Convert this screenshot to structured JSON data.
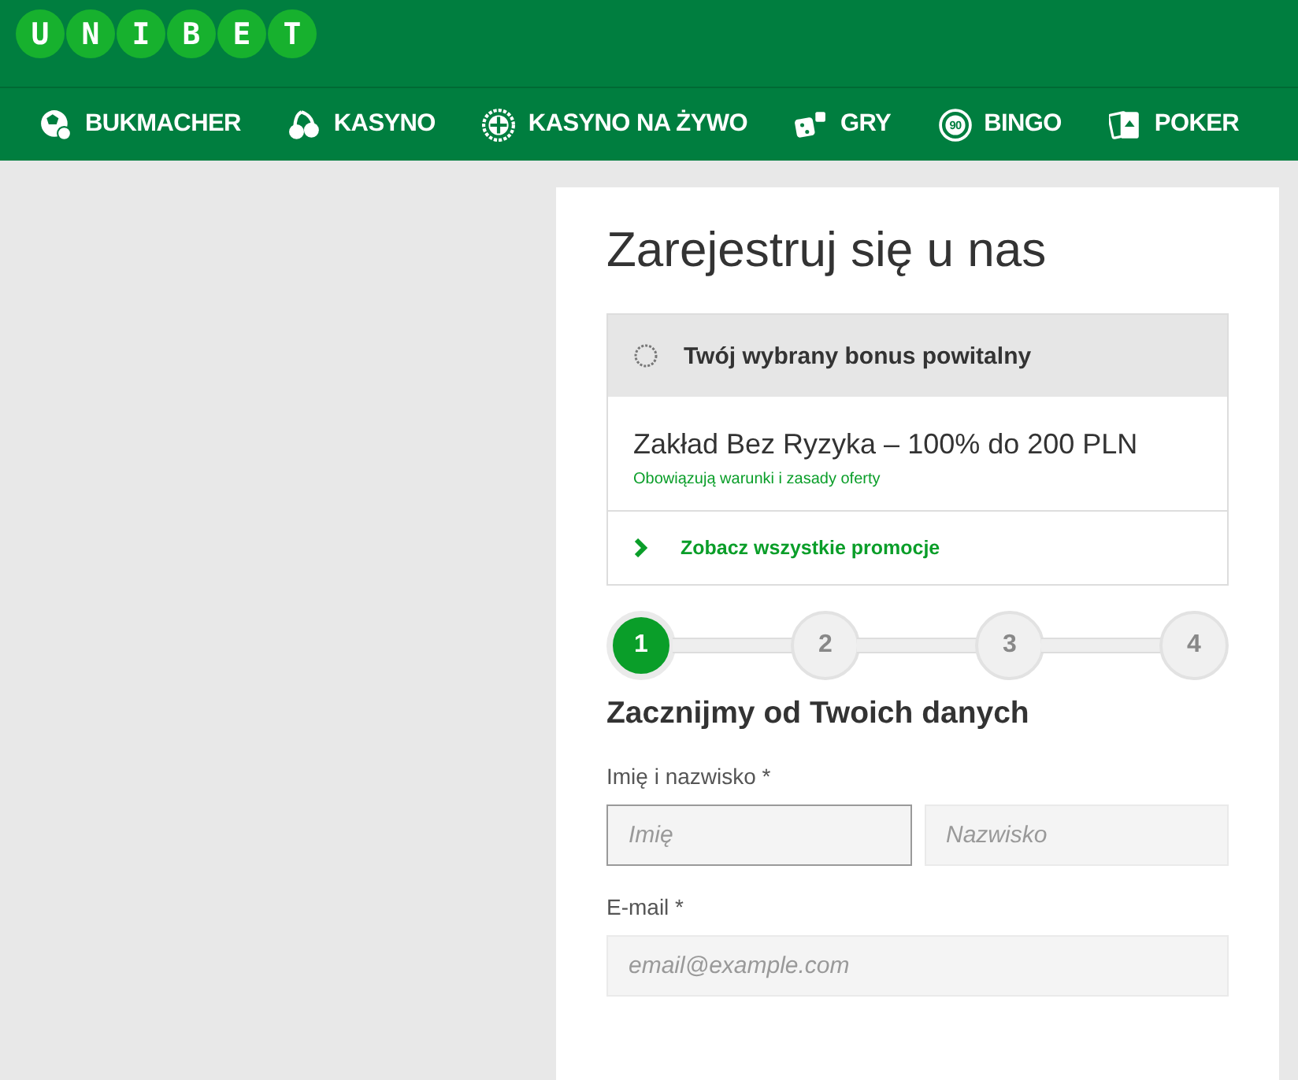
{
  "logo": {
    "letters": [
      "U",
      "N",
      "I",
      "B",
      "E",
      "T"
    ]
  },
  "nav": [
    {
      "label": "BUKMACHER",
      "kind": "ball"
    },
    {
      "label": "KASYNO",
      "kind": "cherry"
    },
    {
      "label": "KASYNO NA ŻYWO",
      "kind": "roulette"
    },
    {
      "label": "GRY",
      "kind": "dice"
    },
    {
      "label": "BINGO",
      "kind": "bingo",
      "badge": "90"
    },
    {
      "label": "POKER",
      "kind": "cards"
    }
  ],
  "title": "Zarejestruj się u nas",
  "bonus": {
    "header": "Twój wybrany bonus powitalny",
    "offer": "Zakład Bez Ryzyka – 100% do 200 PLN",
    "terms": "Obowiązują warunki i zasady oferty",
    "link": "Zobacz wszystkie promocje"
  },
  "steps": [
    {
      "label": "1",
      "selected": true
    },
    {
      "label": "2",
      "selected": false
    },
    {
      "label": "3",
      "selected": false
    },
    {
      "label": "4",
      "selected": false
    }
  ],
  "section_title": "Zacznijmy od Twoich danych",
  "fields": [
    {
      "label": "Imię i nazwisko *",
      "inputs": [
        {
          "placeholder": "Imię",
          "focused": true
        },
        {
          "placeholder": "Nazwisko",
          "focused": false
        }
      ]
    },
    {
      "label": "E-mail *",
      "inputs": [
        {
          "placeholder": "email@example.com",
          "focused": false
        }
      ]
    }
  ]
}
